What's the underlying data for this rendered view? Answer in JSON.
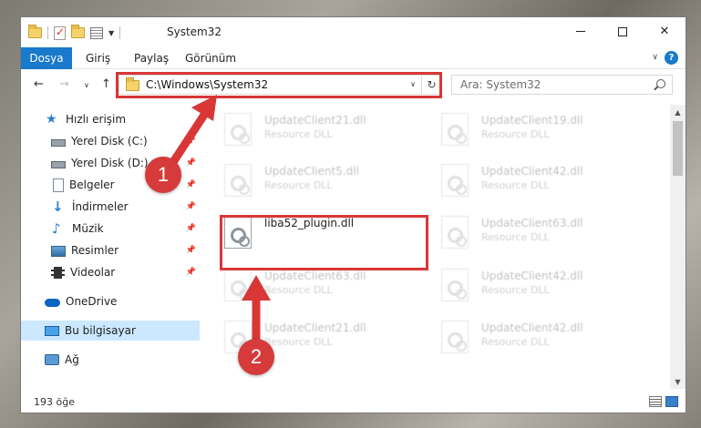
{
  "window": {
    "title": "System32"
  },
  "ribbon": {
    "tabs": [
      "Dosya",
      "Giriş",
      "Paylaş",
      "Görünüm"
    ],
    "help": "?"
  },
  "nav": {
    "address": "C:\\Windows\\System32",
    "search_placeholder": "Ara: System32"
  },
  "sidebar": {
    "quick_access": "Hızlı erişim",
    "items": [
      {
        "label": "Yerel Disk (C:)",
        "icon": "disk-icon",
        "pinned": true
      },
      {
        "label": "Yerel Disk (D:)",
        "icon": "disk-icon",
        "pinned": true
      },
      {
        "label": "Belgeler",
        "icon": "documents-icon",
        "pinned": true
      },
      {
        "label": "İndirmeler",
        "icon": "downloads-icon",
        "pinned": true
      },
      {
        "label": "Müzik",
        "icon": "music-icon",
        "pinned": true
      },
      {
        "label": "Resimler",
        "icon": "pictures-icon",
        "pinned": true
      },
      {
        "label": "Videolar",
        "icon": "videos-icon",
        "pinned": true
      }
    ],
    "onedrive": "OneDrive",
    "this_pc": "Bu bilgisayar",
    "network": "Ağ"
  },
  "files": [
    {
      "name": "UpdateClient21.dll",
      "type": "Resource DLL"
    },
    {
      "name": "UpdateClient19.dll",
      "type": "Resource DLL"
    },
    {
      "name": "UpdateClient5.dll",
      "type": "Resource DLL"
    },
    {
      "name": "UpdateClient42.dll",
      "type": "Resource DLL"
    },
    {
      "name": "liba52_plugin.dll",
      "type": ""
    },
    {
      "name": "UpdateClient63.dll",
      "type": "Resource DLL"
    },
    {
      "name": "UpdateClient63.dll",
      "type": "Resource DLL"
    },
    {
      "name": "UpdateClient42.dll",
      "type": "Resource DLL"
    },
    {
      "name": "UpdateClient21.dll",
      "type": "Resource DLL"
    },
    {
      "name": "UpdateClient42.dll",
      "type": "Resource DLL"
    }
  ],
  "status": {
    "count": "193 öğe"
  },
  "annotations": {
    "step1": "1",
    "step2": "2",
    "color": "#d93636"
  }
}
